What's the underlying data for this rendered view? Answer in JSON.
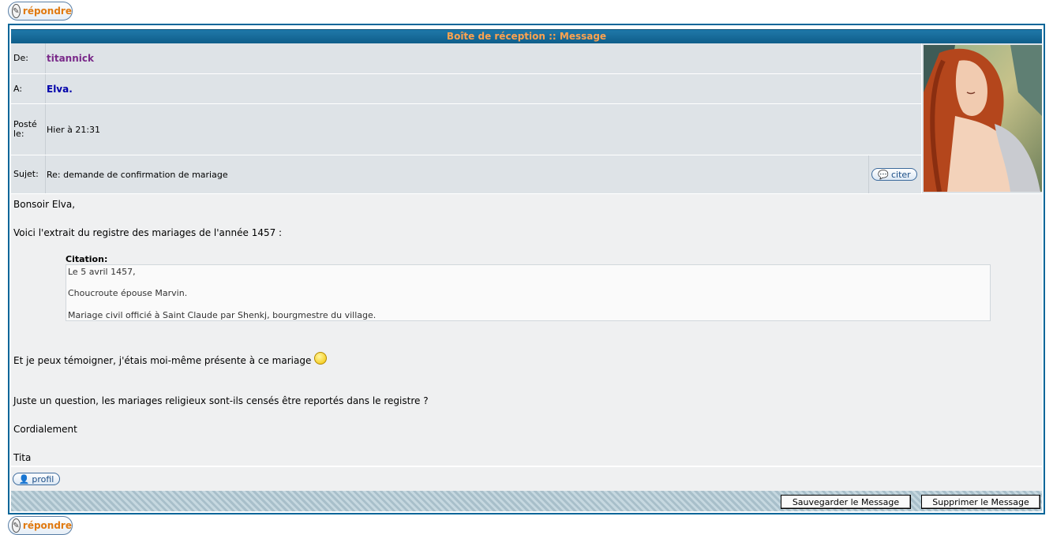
{
  "actions": {
    "reply_label": "répondre"
  },
  "header": {
    "title": "Boîte de réception :: Message"
  },
  "message": {
    "from_label": "De:",
    "from_value": "titannick",
    "to_label": "A:",
    "to_value": "Elva.",
    "date_label": "Posté le:",
    "date_value": "Hier à 21:31",
    "subject_label": "Sujet:",
    "subject_value": "Re: demande de confirmation de mariage",
    "quote_button": "citer"
  },
  "body": {
    "greeting": "Bonsoir Elva,",
    "line1": "Voici l'extrait du registre des mariages de l'année 1457 :",
    "quote_title": "Citation:",
    "quote_lines": [
      "Le 5 avril 1457,",
      "Choucroute épouse Marvin.",
      "Mariage civil officié à Saint Claude par Shenkj, bourgmestre du village."
    ],
    "line2": "Et je peux témoigner, j'étais moi-même présente à ce mariage",
    "line3": "Juste un question, les mariages religieux sont-ils censés être reportés dans le registre ?",
    "line4": "Cordialement",
    "signature": "Tita"
  },
  "profile": {
    "button": "profil"
  },
  "footer": {
    "save_label": "Sauvegarder le Message",
    "delete_label": "Supprimer le Message"
  },
  "colors": {
    "title_bg": "#1f78a9",
    "title_text": "#ffa34f",
    "row_bg": "#dee3e7",
    "body_bg": "#eff0f1",
    "from_color": "#7a2a8a",
    "to_color": "#0000aa"
  }
}
